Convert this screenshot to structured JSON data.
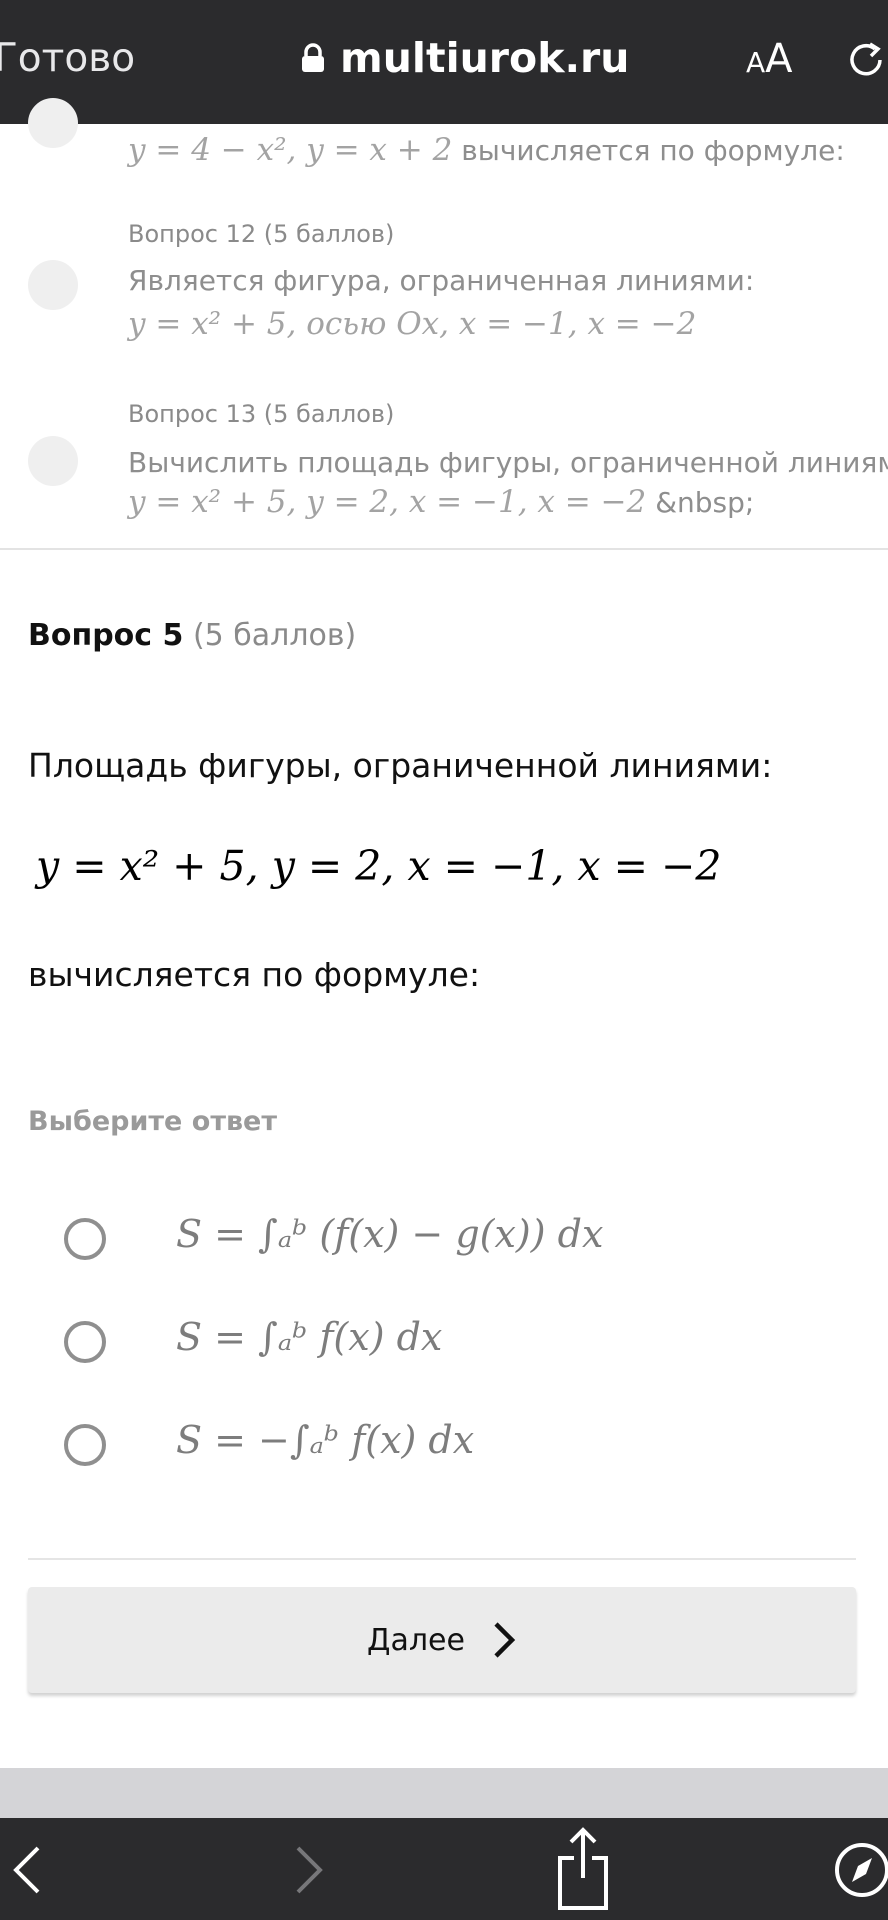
{
  "browser": {
    "done_label": "Готово",
    "url": "multiurok.ru",
    "text_size_label": "AA"
  },
  "prev_questions": {
    "q11_tail": "y = 4 − x², y = x + 2",
    "q11_tail_suffix": "вычисляется по формуле:",
    "q12_meta": "Вопрос 12 (5 баллов)",
    "q12_text": "Является фигура, ограниченная линиями:",
    "q12_formula": "y = x² + 5,   осью Ox,   x = −1,   x = −2",
    "q13_meta": "Вопрос 13 (5 баллов)",
    "q13_text": "Вычислить площадь фигуры, ограниченной линиями:",
    "q13_formula": "y = x² + 5,   y = 2,   x = −1,   x = −2",
    "q13_formula_suffix": "&nbsp;"
  },
  "question": {
    "label": "Вопрос 5",
    "points": "(5 баллов)",
    "text": "Площадь фигуры, ограниченной линиями:",
    "formula": "y = x² + 5,   y = 2,   x = −1,   x = −2",
    "text2": "вычисляется по формуле:",
    "choose_label": "Выберите ответ"
  },
  "options": [
    {
      "formula": "S = ∫ₐᵇ (f(x) − g(x)) dx"
    },
    {
      "formula": "S = ∫ₐᵇ f(x) dx"
    },
    {
      "formula": "S = −∫ₐᵇ f(x) dx"
    }
  ],
  "next_button": {
    "label": "Далее"
  },
  "icons": [
    "lock-icon",
    "reload-icon",
    "chevron-right-icon",
    "back-icon",
    "forward-icon",
    "share-icon",
    "compass-icon"
  ]
}
